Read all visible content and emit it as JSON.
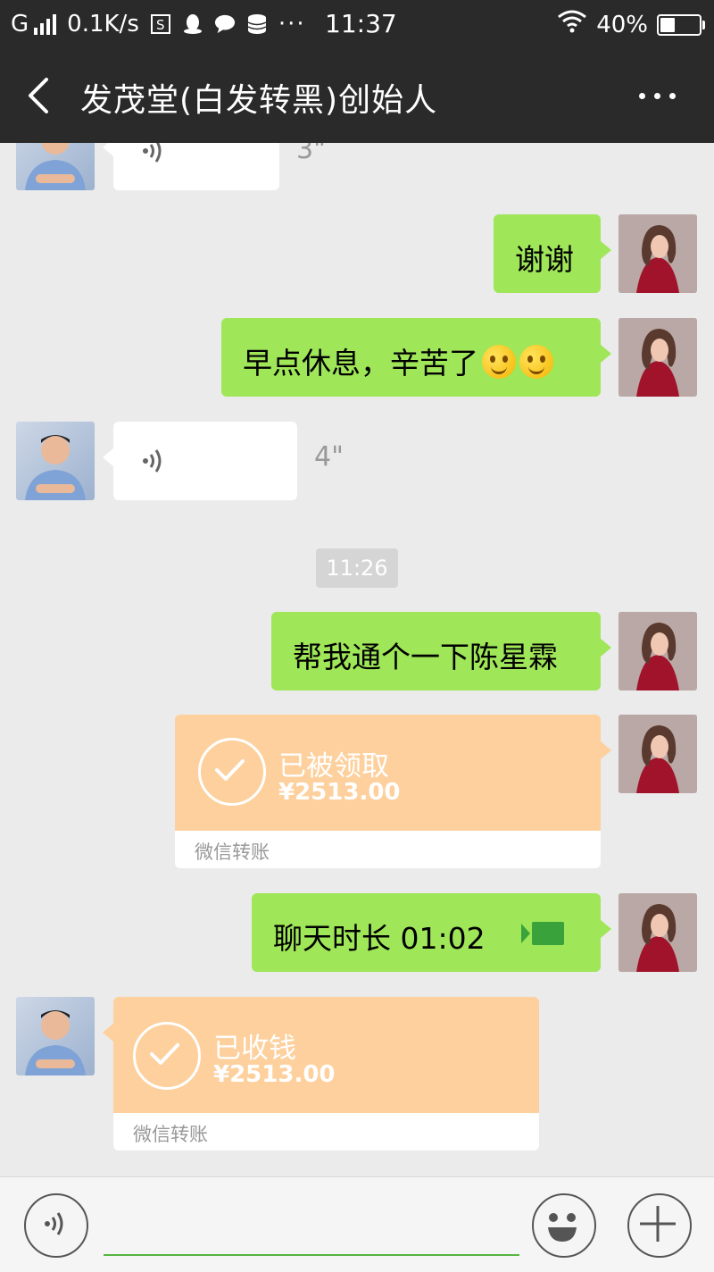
{
  "status_bar": {
    "network": "G",
    "speed": "0.1K/s",
    "time": "11:37",
    "battery_percent": "40%",
    "battery_level": 0.4
  },
  "header": {
    "title": "发茂堂(白发转黑)创始人"
  },
  "messages": [
    {
      "id": "voice-1",
      "side": "left",
      "type": "voice",
      "duration": "3\""
    },
    {
      "id": "text-1",
      "side": "right",
      "type": "text",
      "text": "谢谢"
    },
    {
      "id": "text-2",
      "side": "right",
      "type": "text",
      "text": "早点休息，辛苦了"
    },
    {
      "id": "voice-2",
      "side": "left",
      "type": "voice",
      "duration": "4\""
    },
    {
      "id": "time-1",
      "type": "timestamp",
      "text": "11:26"
    },
    {
      "id": "text-3",
      "side": "right",
      "type": "text",
      "text": "帮我通个一下陈星霖"
    },
    {
      "id": "transfer-1",
      "side": "right",
      "type": "transfer",
      "title": "已被领取",
      "amount": "¥2513.00",
      "footer": "微信转账"
    },
    {
      "id": "call-1",
      "side": "right",
      "type": "video-call",
      "text": "聊天时长 01:02"
    },
    {
      "id": "transfer-2",
      "side": "left",
      "type": "transfer",
      "title": "已收钱",
      "amount": "¥2513.00",
      "footer": "微信转账"
    }
  ],
  "colors": {
    "bar": "#2a2a2a",
    "chat_bg": "#ebebeb",
    "bubble_green": "#9fe658",
    "transfer_orange": "#fdd09d",
    "input_underline": "#57b643"
  },
  "icons": {
    "back": "chevron-left-icon",
    "more": "more-dots-icon",
    "voice": "voice-wave-icon",
    "emoji": "smiley-icon",
    "plus": "plus-icon",
    "video": "video-camera-icon"
  }
}
